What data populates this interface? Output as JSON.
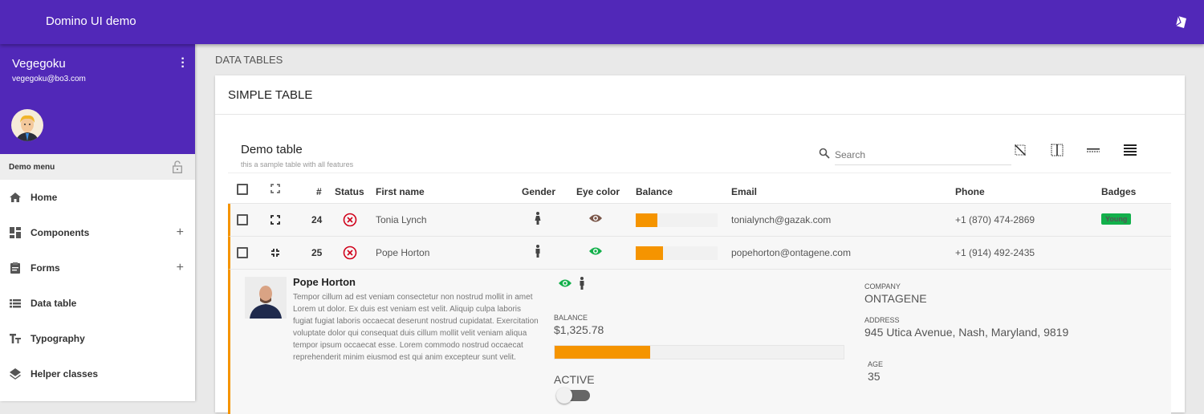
{
  "app": {
    "title": "Domino UI demo"
  },
  "user": {
    "name": "Vegegoku",
    "email": "vegegoku@bo3.com"
  },
  "sidebar": {
    "menu_title": "Demo menu",
    "items": [
      {
        "label": "Home"
      },
      {
        "label": "Components",
        "expandable": "+"
      },
      {
        "label": "Forms",
        "expandable": "+"
      },
      {
        "label": "Data table"
      },
      {
        "label": "Typography"
      },
      {
        "label": "Helper classes"
      }
    ]
  },
  "breadcrumb": "DATA TABLES",
  "card": {
    "title": "SIMPLE TABLE"
  },
  "table": {
    "title": "Demo table",
    "subtitle": "this a sample table with all features",
    "search_placeholder": "Search",
    "columns": [
      "#",
      "Status",
      "First name",
      "Gender",
      "Eye color",
      "Balance",
      "Email",
      "Phone",
      "Badges"
    ],
    "rows": [
      {
        "id": "24",
        "name": "Tonia Lynch",
        "gender": "female",
        "eye_color": "brown",
        "eye_hex": "#795548",
        "balance_fraction": 0.26,
        "email": "tonialynch@gazak.com",
        "phone": "+1 (870) 474-2869",
        "badge": "Young",
        "expanded": false
      },
      {
        "id": "25",
        "name": "Pope Horton",
        "gender": "male",
        "eye_color": "green",
        "eye_hex": "#13b04b",
        "balance_fraction": 0.33,
        "email": "popehorton@ontagene.com",
        "phone": "+1 (914) 492-2435",
        "badge": "",
        "expanded": true
      }
    ]
  },
  "detail": {
    "name": "Pope Horton",
    "about": "Tempor cillum ad est veniam consectetur non nostrud mollit in amet Lorem ut dolor. Ex duis est veniam est velit. Aliquip culpa laboris fugiat fugiat laboris occaecat deserunt nostrud cupidatat. Exercitation voluptate dolor qui consequat duis cillum mollit velit veniam aliqua tempor ipsum occaecat esse. Lorem commodo nostrud occaecat reprehenderit minim eiusmod est qui anim excepteur sunt velit.",
    "balance_label": "BALANCE",
    "balance": "$1,325.78",
    "balance_fraction": 0.33,
    "active_label": "ACTIVE",
    "active": false,
    "company_label": "COMPANY",
    "company": "ONTAGENE",
    "address_label": "ADDRESS",
    "address": "945 Utica Avenue, Nash, Maryland, 9819",
    "age_label": "AGE",
    "age": "35"
  },
  "colors": {
    "primary": "#5128b8",
    "accent": "#f59400",
    "danger": "#d0021b",
    "success": "#12b04b"
  }
}
